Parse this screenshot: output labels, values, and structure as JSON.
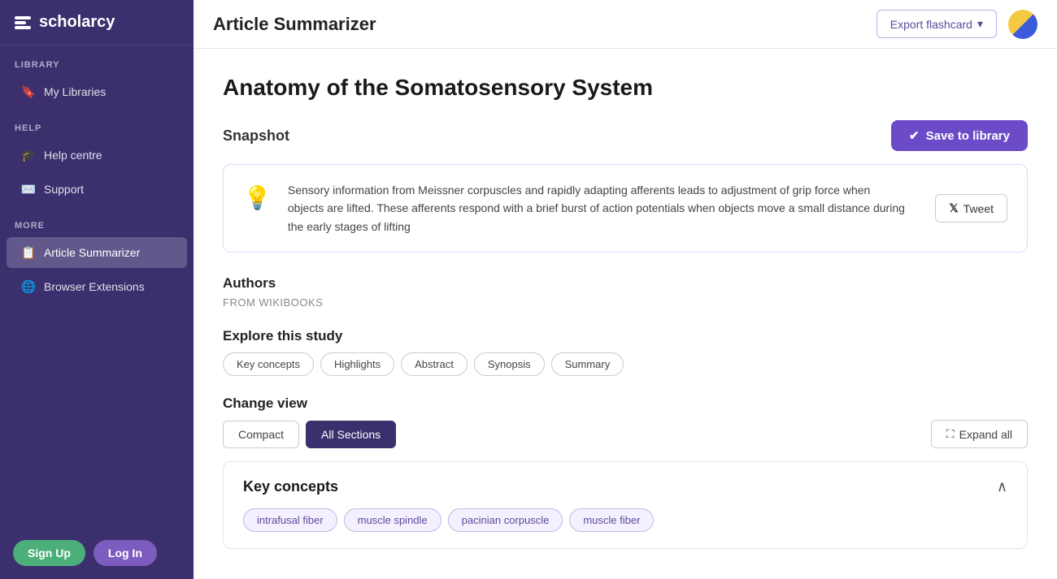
{
  "app": {
    "logo_text": "scholarcy",
    "title": "Article Summarizer"
  },
  "sidebar": {
    "library_label": "LIBRARY",
    "library_items": [
      {
        "label": "My Libraries",
        "icon": "bookmark",
        "active": false
      }
    ],
    "help_label": "HELP",
    "help_items": [
      {
        "label": "Help centre",
        "icon": "graduation"
      },
      {
        "label": "Support",
        "icon": "envelope"
      }
    ],
    "more_label": "MORE",
    "more_items": [
      {
        "label": "Article Summarizer",
        "icon": "article",
        "active": true
      },
      {
        "label": "Browser Extensions",
        "icon": "globe",
        "active": false
      }
    ],
    "signup_label": "Sign Up",
    "login_label": "Log In"
  },
  "topbar": {
    "title": "Article Summarizer",
    "export_label": "Export flashcard",
    "theme_label": "Toggle theme"
  },
  "article": {
    "title": "Anatomy of the Somatosensory System",
    "snapshot_label": "Snapshot",
    "save_label": "Save to library",
    "snapshot_text": "Sensory information from Meissner corpuscles and rapidly adapting afferents leads to adjustment of grip force when objects are lifted. These afferents respond with a brief burst of action potentials when objects move a small distance during the early stages of lifting",
    "tweet_label": "Tweet",
    "authors_label": "Authors",
    "authors_from": "FROM WIKIBOOKS",
    "explore_label": "Explore this study",
    "explore_chips": [
      "Key concepts",
      "Highlights",
      "Abstract",
      "Synopsis",
      "Summary"
    ],
    "change_view_label": "Change view",
    "view_compact": "Compact",
    "view_all_sections": "All Sections",
    "expand_all_label": "Expand all",
    "key_concepts_label": "Key concepts",
    "key_concept_tags": [
      "intrafusal fiber",
      "muscle spindle",
      "pacinian corpuscle",
      "muscle fiber"
    ]
  }
}
